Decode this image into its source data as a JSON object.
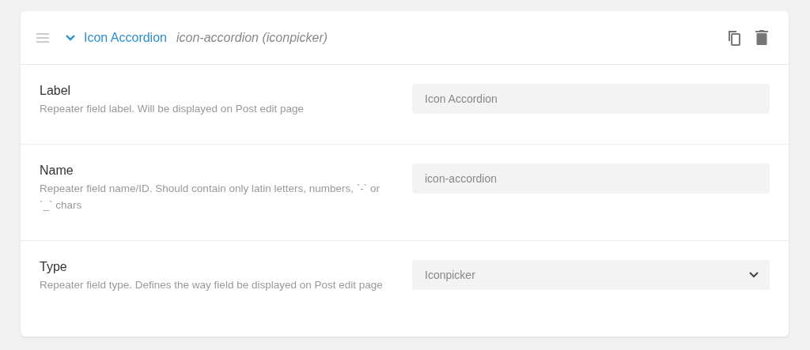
{
  "header": {
    "title": "Icon Accordion",
    "subtitle": "icon-accordion (iconpicker)",
    "expanded": true
  },
  "fields": [
    {
      "kind": "input",
      "label": "Label",
      "description": "Repeater field label. Will be displayed on Post edit page",
      "value": "Icon Accordion"
    },
    {
      "kind": "input",
      "label": "Name",
      "description": "Repeater field name/ID. Should contain only latin letters, numbers, `-` or `_` chars",
      "value": "icon-accordion"
    },
    {
      "kind": "select",
      "label": "Type",
      "description": "Repeater field type. Defines the way field be displayed on Post edit page",
      "value": "Iconpicker"
    }
  ]
}
